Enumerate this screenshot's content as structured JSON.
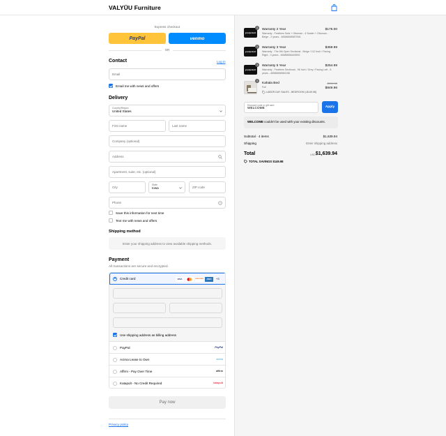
{
  "header": {
    "brand": "VALYŪU Furniture",
    "cart_icon": "shopping-bag-icon"
  },
  "express": {
    "title": "Express checkout",
    "paypal_label": "PayPal",
    "venmo_label": "venmo",
    "or_label": "OR"
  },
  "contact": {
    "heading": "Contact",
    "login_link": "Log in",
    "email_placeholder": "Email",
    "news_label": "Email me with news and offers",
    "news_checked": true
  },
  "delivery": {
    "heading": "Delivery",
    "country_label": "Country/Region",
    "country_value": "United States",
    "first_name": "First name",
    "last_name": "Last name",
    "company": "Company (optional)",
    "address": "Address",
    "apartment": "Apartment, suite, etc. (optional)",
    "city": "City",
    "state_label": "State",
    "state_value": "Iowa",
    "zip": "ZIP code",
    "phone": "Phone",
    "save_label": "Save this information for next time",
    "text_label": "Text me with news and offers"
  },
  "shipping": {
    "heading": "Shipping method",
    "message": "Enter your shipping address to view available shipping methods."
  },
  "payment": {
    "heading": "Payment",
    "subtitle": "All transactions are secure and encrypted.",
    "credit_card": "Credit card",
    "card_brands": [
      "VISA",
      "MC",
      "DISCOVER",
      "AMEX"
    ],
    "more_cards": "+3",
    "billing_label": "Use shipping address as billing address",
    "options": [
      {
        "label": "PayPal",
        "logo": "PayPal"
      },
      {
        "label": "Acima Lease to Own",
        "logo": "acima"
      },
      {
        "label": "Affirm - Pay Over Time",
        "logo": "affirm"
      },
      {
        "label": "Katapult - No Credit Required",
        "logo": "katapult"
      }
    ],
    "pay_button": "Pay now"
  },
  "footer": {
    "privacy": "Privacy policy"
  },
  "order": {
    "items": [
      {
        "qty": "1",
        "thumb": "yourprotect",
        "title": "Warranty 2 Year",
        "sub": "Warranty - Feathers Sofa + Ottoman - 4 Seater + Ottoman - Beige - 2 years - 46586658587006",
        "price": "$175.00"
      },
      {
        "qty": "1",
        "thumb": "yourprotect",
        "title": "Warranty 3 Year",
        "sub": "Warranty - The 5th Open Sectional - Beige / 112 Inch / Facing Right - 3 years - 46586658445592",
        "price": "$359.99"
      },
      {
        "qty": "1",
        "thumb": "yourprotect",
        "title": "Warranty 5 Year",
        "sub": "Warranty - Feathers Sectional - 96 Inch / Grey / Facing Left - 5 years - 46586658584156",
        "price": "$254.99"
      },
      {
        "qty": "1",
        "title": "Kahala Bed",
        "sub": "Full",
        "discount": "LABOR DAY SALES - BEDROOM (-$149.98)",
        "old_price": "$999.95",
        "price": "$849.96"
      }
    ],
    "discount_label": "Discount code or gift card",
    "discount_value": "WELCOME",
    "apply": "Apply",
    "discount_error_code": "WELCOME",
    "discount_error": " couldn't be used with your existing discounts.",
    "subtotal_label": "Subtotal · 4 items",
    "subtotal_value": "$1,639.94",
    "shipping_label": "Shipping",
    "shipping_value": "Enter shipping address",
    "total_label": "Total",
    "currency": "USD",
    "total_value": "$1,639.94",
    "savings_label": "TOTAL SAVINGS",
    "savings_value": "$149.98"
  },
  "colors": {
    "accent": "#1a73e8",
    "paypal": "#ffc439",
    "venmo": "#008cff"
  }
}
